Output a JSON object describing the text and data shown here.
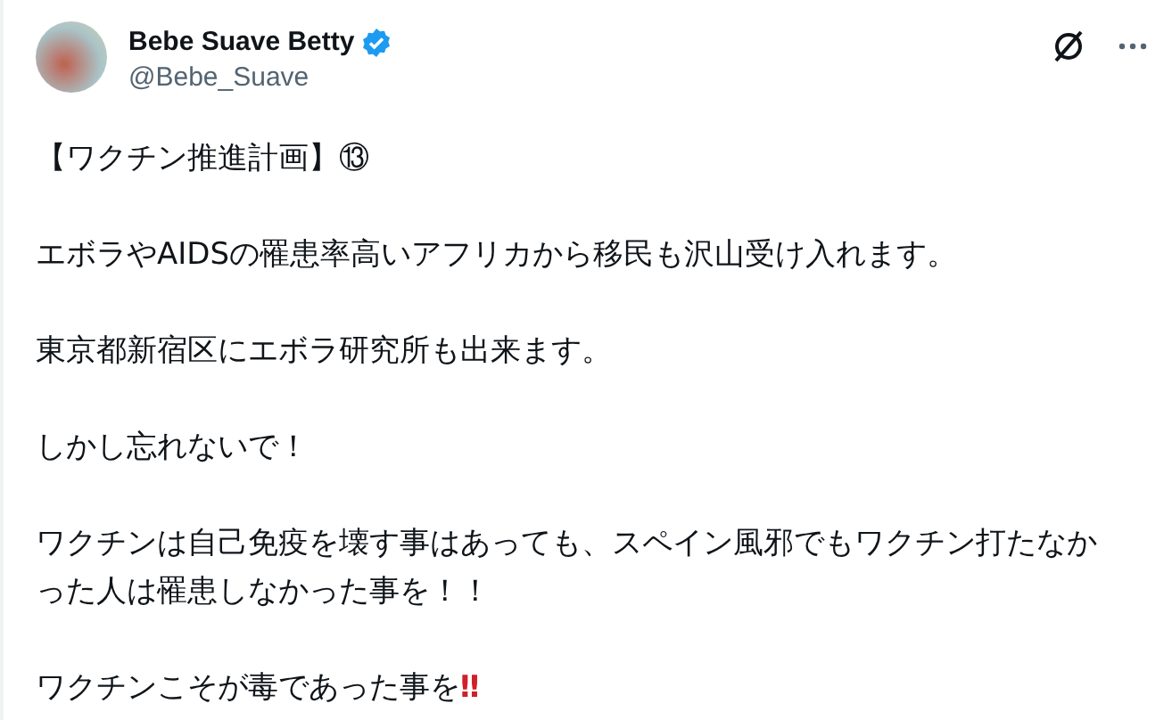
{
  "author": {
    "name": "Bebe Suave Betty",
    "verified": true,
    "handle": "@Bebe_Suave"
  },
  "body": [
    {
      "text": "【ワクチン推進計画】⑬"
    },
    {
      "text": "エボラやAIDSの罹患率高いアフリカから移民も沢山受け入れます。"
    },
    {
      "text": "東京都新宿区にエボラ研究所も出来ます。"
    },
    {
      "text": "しかし忘れないで！"
    },
    {
      "text": "ワクチンは自己免疫を壊す事はあっても、スペイン風邪でもワクチン打たなかった人は罹患しなかった事を！！"
    },
    {
      "text": "ワクチンこそが毒であった事を",
      "emphasis": "‼"
    }
  ]
}
